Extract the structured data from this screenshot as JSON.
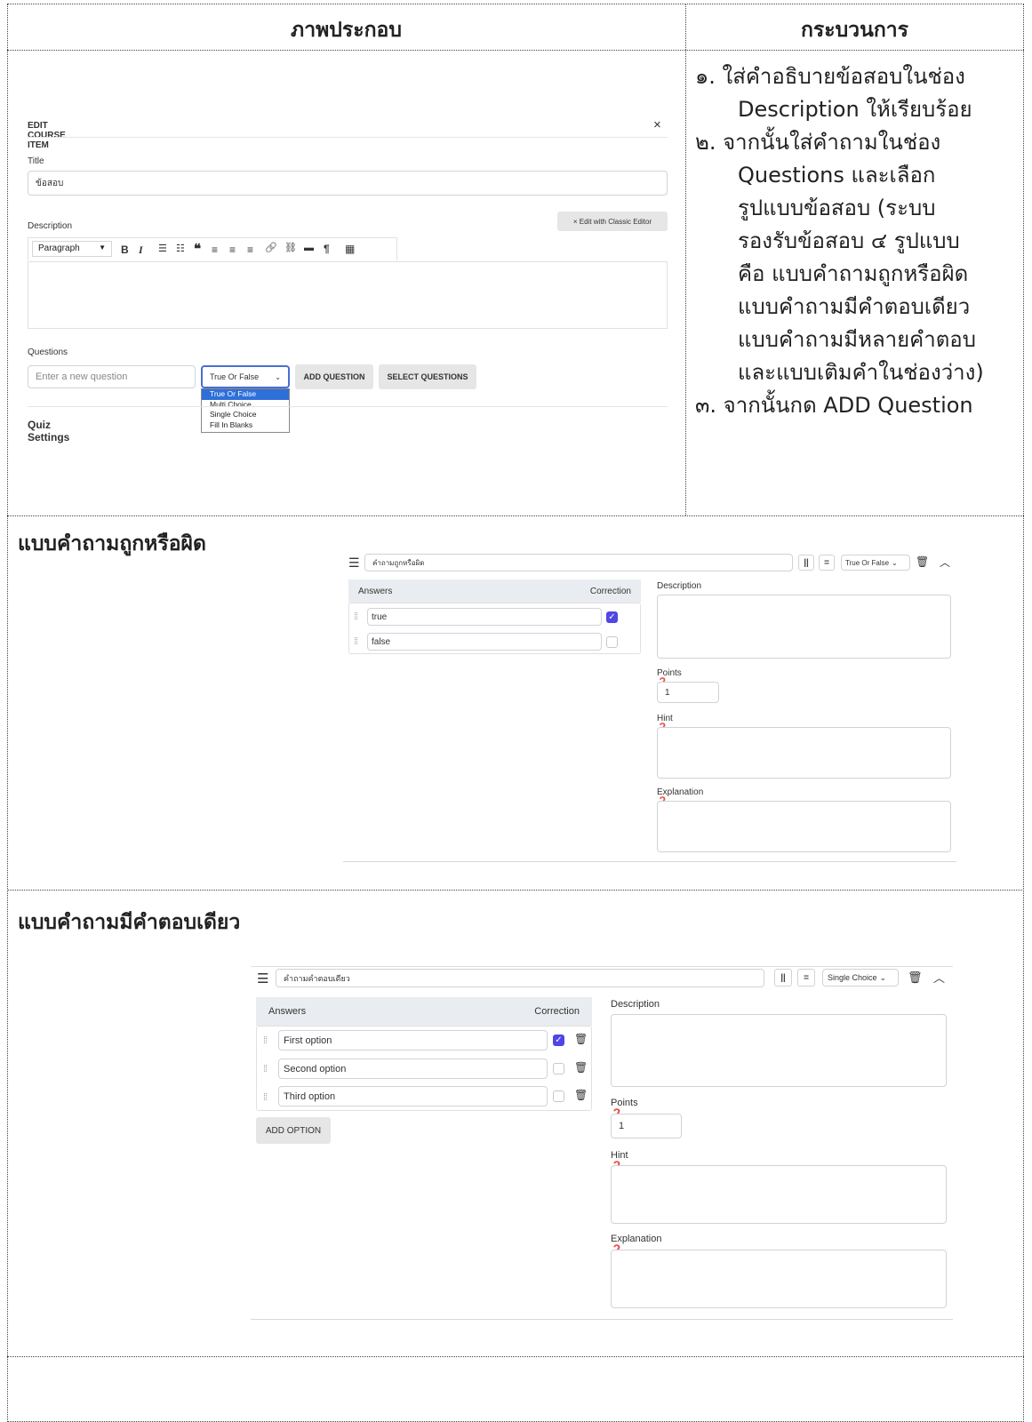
{
  "table": {
    "col1_header": "ภาพประกอบ",
    "col2_header": "กระบวนการ",
    "steps": [
      "๑. ใส่คำอธิบายข้อสอบในช่อง",
      "Description ให้เรียบร้อย",
      "๒. จากนั้นใส่คำถามในช่อง",
      "Questions และเลือก",
      "รูปแบบข้อสอบ (ระบบ",
      "รองรับข้อสอบ ๔ รูปแบบ",
      "คือ แบบคำถามถูกหรือผิด",
      "แบบคำถามมีคำตอบเดียว",
      "แบบคำถามมีหลายคำตอบ",
      "และแบบเติมคำในช่องว่าง)",
      "๓.  จากนั้นกด ADD Question"
    ],
    "section_true_false": "แบบคำถามถูกหรือผิด",
    "section_single": "แบบคำถามมีคำตอบเดียว"
  },
  "edit_item": {
    "header": "EDIT COURSE ITEM",
    "close": "×",
    "title_label": "Title",
    "title_value": "ข้อสอบ",
    "description_label": "Description",
    "classic_editor_button": "× Edit with Classic Editor",
    "toolbar_paragraph": "Paragraph",
    "toolbar_icons": [
      "B",
      "I",
      "☰",
      "☷",
      "❝",
      "≡",
      "≡",
      "≡",
      "🔗",
      "⛓",
      "▬",
      "¶",
      "▦"
    ],
    "questions_label": "Questions",
    "question_placeholder": "Enter a new question",
    "type_select": "True Or False",
    "type_options": [
      "True Or False",
      "Multi Choice",
      "Single Choice",
      "Fill In Blanks"
    ],
    "add_question": "ADD QUESTION",
    "select_questions": "SELECT QUESTIONS",
    "quiz_settings": "Quiz Settings"
  },
  "tf_question": {
    "title": "คำถามถูกหรือผิด",
    "type": "True Or False",
    "answers_header": "Answers",
    "correction_header": "Correction",
    "answers": [
      {
        "text": "true",
        "correct": true
      },
      {
        "text": "false",
        "correct": false
      }
    ],
    "description_label": "Description",
    "points_label": "Points",
    "points_value": "1",
    "hint_label": "Hint",
    "explanation_label": "Explanation"
  },
  "single_question": {
    "title": "คำถามคำตอบเดียว",
    "type": "Single Choice",
    "answers_header": "Answers",
    "correction_header": "Correction",
    "answers": [
      {
        "text": "First option",
        "correct": true
      },
      {
        "text": "Second option",
        "correct": false
      },
      {
        "text": "Third option",
        "correct": false
      }
    ],
    "add_option": "ADD OPTION",
    "description_label": "Description",
    "points_label": "Points",
    "points_value": "1",
    "hint_label": "Hint",
    "explanation_label": "Explanation"
  }
}
